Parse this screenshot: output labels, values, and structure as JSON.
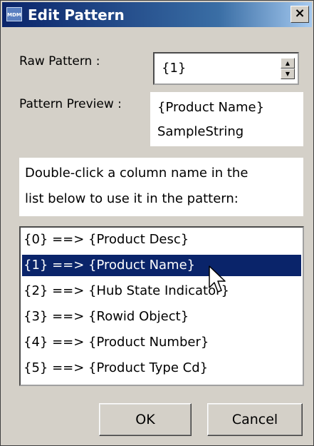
{
  "window": {
    "title": "Edit Pattern",
    "icon_text": "MDM",
    "close_glyph": "×"
  },
  "raw_pattern": {
    "label": "Raw Pattern :",
    "value": "{1}",
    "spin_up": "▲",
    "spin_down": "▼"
  },
  "preview": {
    "label": "Pattern Preview :",
    "line1": "{Product Name}",
    "line2": "SampleString"
  },
  "instructions": {
    "line1": "Double-click a column name in the",
    "line2": "list below to use it in the pattern:"
  },
  "columns": {
    "selected_index": 1,
    "items": [
      "{0} ==> {Product Desc}",
      "{1} ==> {Product Name}",
      "{2} ==> {Hub State Indicator}",
      "{3} ==> {Rowid Object}",
      "{4} ==> {Product Number}",
      "{5} ==> {Product Type Cd}"
    ]
  },
  "buttons": {
    "ok": "OK",
    "cancel": "Cancel"
  },
  "colors": {
    "selection": "#0a246a",
    "dialog_bg": "#d4d0c8"
  }
}
